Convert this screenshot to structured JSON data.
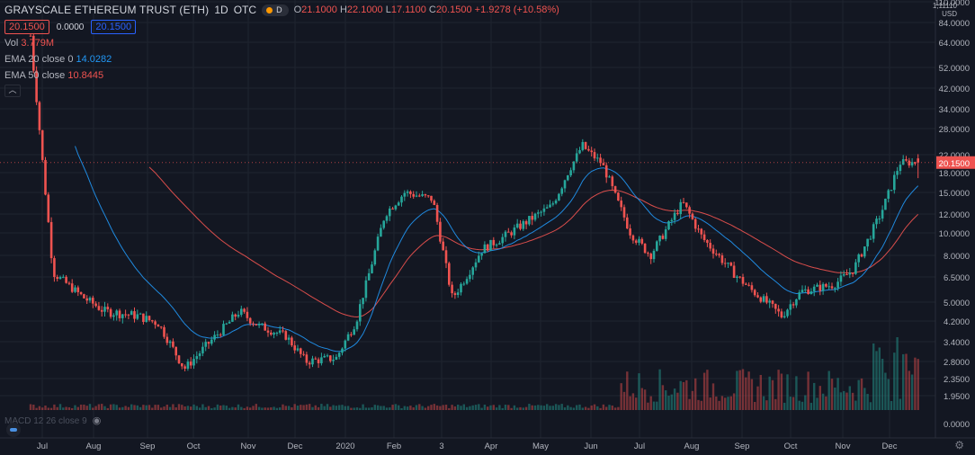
{
  "legend": {
    "title": "GRAYSCALE ETHEREUM TRUST (ETH)",
    "interval": "1D",
    "exchange": "OTC",
    "badge_letter": "D",
    "ohlc": {
      "o_label": "O",
      "o": "21.1000",
      "h_label": "H",
      "h": "22.1000",
      "l_label": "L",
      "l": "17.1100",
      "c_label": "C",
      "c": "20.1500",
      "change": "+1.9278 (+10.58%)"
    },
    "bid": "20.1500",
    "spread": "0.0000",
    "ask": "20.1500"
  },
  "indicators": {
    "vol": {
      "label": "Vol",
      "value": "3.779M"
    },
    "ema20": {
      "label": "EMA 20 close 0",
      "value": "14.0282"
    },
    "ema50": {
      "label": "EMA 50 close",
      "value": "10.8445"
    },
    "collapse_icon": "chevron-up-icon"
  },
  "macd_label": "MACD 12 26 close 9",
  "price_axis": {
    "currency_top": "1,11110",
    "currency": "USD",
    "ticks": [
      "110.0000",
      "84.0000",
      "64.0000",
      "52.0000",
      "42.0000",
      "34.0000",
      "28.0000",
      "22.0000",
      "18.0000",
      "15.0000",
      "12.0000",
      "10.0000",
      "8.0000",
      "6.5000",
      "5.0000",
      "4.2000",
      "3.4000",
      "2.8000",
      "2.3500",
      "1.9500",
      "0.0000"
    ],
    "last_price": "20.1500",
    "last_price_color": "#ef5350"
  },
  "time_axis": [
    "Jul",
    "Aug",
    "Sep",
    "Oct",
    "Nov",
    "Dec",
    "2020",
    "Feb",
    "3",
    "Apr",
    "May",
    "Jun",
    "Jul",
    "Aug",
    "Sep",
    "Oct",
    "Nov",
    "Dec"
  ],
  "colors": {
    "up": "#26a69a",
    "down": "#ef5350",
    "ema20": "#2196f3",
    "ema50": "#ef5350",
    "bg": "#131722",
    "grid": "#1f2430"
  },
  "chart_data": {
    "type": "candlestick",
    "scale": "log",
    "ylim": [
      1.95,
      110
    ],
    "series": [
      {
        "name": "EMA 20 close 0",
        "values": [
          14.0282
        ]
      },
      {
        "name": "EMA 50 close",
        "values": [
          10.8445
        ]
      }
    ],
    "last": {
      "o": 21.1,
      "h": 22.1,
      "l": 17.11,
      "c": 20.15
    },
    "price_path": [
      [
        "Jul",
        70,
        6.8
      ],
      [
        "Aug",
        5.2,
        4.6
      ],
      [
        "Sep",
        4.4,
        4.1
      ],
      [
        "Oct",
        2.6,
        3.2
      ],
      [
        "Nov",
        4.6,
        4.0
      ],
      [
        "Dec",
        3.6,
        2.8
      ],
      [
        "2020",
        2.9,
        4.2
      ],
      [
        "Feb",
        12.0,
        15.0
      ],
      [
        "3",
        14.0,
        5.2
      ],
      [
        "Apr",
        8.5,
        9.5
      ],
      [
        "May",
        11.5,
        13.0
      ],
      [
        "Jun",
        24.0,
        20.0
      ],
      [
        "Jul",
        10.0,
        8.0
      ],
      [
        "Aug",
        13.5,
        9.5
      ],
      [
        "Sep",
        6.8,
        5.6
      ],
      [
        "Oct",
        4.4,
        5.6
      ],
      [
        "Nov",
        6.0,
        7.0
      ],
      [
        "Dec",
        12.0,
        20.15
      ]
    ]
  },
  "settings_icon": "gear-icon"
}
